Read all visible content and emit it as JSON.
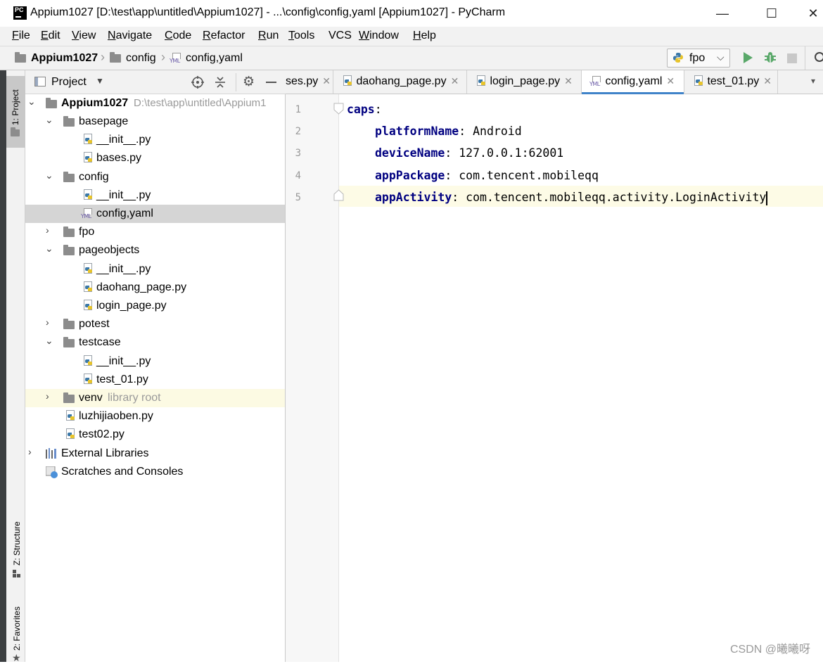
{
  "window": {
    "title": "Appium1027 [D:\\test\\app\\untitled\\Appium1027] - ...\\config\\config,yaml [Appium1027] - PyCharm",
    "app_icon_text": "PC",
    "minimize": "—",
    "maximize": "☐",
    "close": "✕"
  },
  "menu": [
    {
      "label": "File",
      "u": "F",
      "rest": "ile"
    },
    {
      "label": "Edit",
      "u": "E",
      "rest": "dit"
    },
    {
      "label": "View",
      "u": "V",
      "rest": "iew"
    },
    {
      "label": "Navigate",
      "u": "N",
      "rest": "avigate"
    },
    {
      "label": "Code",
      "u": "C",
      "rest": "ode"
    },
    {
      "label": "Refactor",
      "u": "R",
      "rest": "efactor"
    },
    {
      "label": "Run",
      "u": "R",
      "rest": "un"
    },
    {
      "label": "Tools",
      "u": "T",
      "rest": "ools"
    },
    {
      "label": "VCS",
      "u": "",
      "rest": "VCS"
    },
    {
      "label": "Window",
      "u": "W",
      "rest": "indow"
    },
    {
      "label": "Help",
      "u": "H",
      "rest": "elp"
    }
  ],
  "breadcrumb": {
    "project": "Appium1027",
    "folder": "config",
    "file": "config,yaml"
  },
  "run_config": {
    "selected": "fpo"
  },
  "side_tabs": {
    "project": "1: Project",
    "structure": "Z: Structure",
    "favorites": "2: Favorites"
  },
  "project_panel": {
    "title": "Project"
  },
  "tree": {
    "root_name": "Appium1027",
    "root_path": "D:\\test\\app\\untitled\\Appium1",
    "basepage": "basepage",
    "basepage_init": "__init__.py",
    "bases": "bases.py",
    "config": "config",
    "config_init": "__init__.py",
    "config_yaml": "config,yaml",
    "fpo": "fpo",
    "pageobjects": "pageobjects",
    "po_init": "__init__.py",
    "daohang": "daohang_page.py",
    "login": "login_page.py",
    "potest": "potest",
    "testcase": "testcase",
    "tc_init": "__init__.py",
    "test01": "test_01.py",
    "venv": "venv",
    "venv_hint": "library root",
    "luzhi": "luzhijiaoben.py",
    "test02": "test02.py",
    "ext_libs": "External Libraries",
    "scratches": "Scratches and Consoles"
  },
  "tabs": [
    {
      "label": "ses.py"
    },
    {
      "label": "daohang_page.py"
    },
    {
      "label": "login_page.py"
    },
    {
      "label": "config,yaml"
    },
    {
      "label": "test_01.py"
    }
  ],
  "editor": {
    "line_numbers": [
      "1",
      "2",
      "3",
      "4",
      "5"
    ],
    "lines": [
      {
        "key": "caps",
        "value": ""
      },
      {
        "key": "platformName",
        "value": " Android"
      },
      {
        "key": "deviceName",
        "value": " 127.0.0.1:62001"
      },
      {
        "key": "appPackage",
        "value": " com.tencent.mobileqq"
      },
      {
        "key": "appActivity",
        "value": " com.tencent.mobileqq.activity.LoginActivity"
      }
    ]
  },
  "watermark": "CSDN @曦曦呀"
}
